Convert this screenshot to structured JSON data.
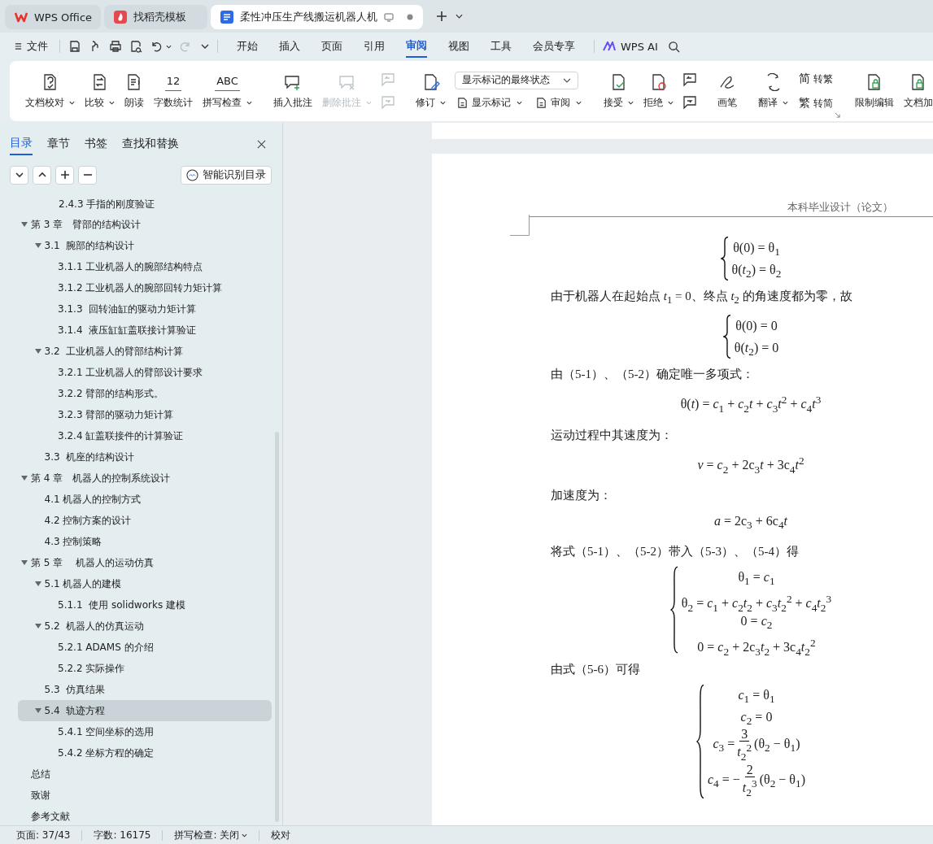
{
  "browser_tabs": [
    {
      "kind": "home",
      "label": "WPS Office",
      "selected": false
    },
    {
      "kind": "template",
      "label": "找稻壳模板",
      "selected": false
    },
    {
      "kind": "document",
      "label": "柔性冲压生产线搬运机器人机",
      "selected": true
    }
  ],
  "menu": {
    "file": "文件",
    "quick_access": [
      {
        "disabled": false,
        "dropdown": false
      },
      {
        "disabled": false,
        "dropdown": false
      },
      {
        "disabled": false,
        "dropdown": false
      },
      {
        "disabled": false,
        "dropdown": false
      },
      {
        "disabled": false,
        "dropdown": true
      },
      {
        "disabled": true,
        "dropdown": false
      }
    ],
    "tabs": [
      {
        "label": "开始",
        "selected": false
      },
      {
        "label": "插入",
        "selected": false
      },
      {
        "label": "页面",
        "selected": false
      },
      {
        "label": "引用",
        "selected": false
      },
      {
        "label": "审阅",
        "selected": true
      },
      {
        "label": "视图",
        "selected": false
      },
      {
        "label": "工具",
        "selected": false
      },
      {
        "label": "会员专享",
        "selected": false
      }
    ],
    "ai": "WPS AI"
  },
  "ribbon": {
    "groups": [
      {
        "items": [
          {
            "kind": "large",
            "label": "文档校对",
            "dropdown": true,
            "disabled": false
          },
          {
            "kind": "large",
            "label": "比较",
            "dropdown": true,
            "disabled": false
          },
          {
            "kind": "large",
            "label": "朗读",
            "dropdown": false,
            "disabled": false
          },
          {
            "kind": "large",
            "label": "字数统计",
            "dropdown": false,
            "disabled": false,
            "icon_text": "12"
          },
          {
            "kind": "large",
            "label": "拼写检查",
            "dropdown": true,
            "disabled": false,
            "icon_text": "ABC"
          }
        ]
      },
      {
        "items": [
          {
            "kind": "large",
            "label": "插入批注",
            "dropdown": false,
            "disabled": false
          },
          {
            "kind": "large",
            "label": "删除批注",
            "dropdown": true,
            "disabled": true
          },
          {
            "kind": "icon_stack",
            "disabled": true
          }
        ]
      },
      {
        "items": [
          {
            "kind": "large",
            "label": "修订",
            "dropdown": true,
            "disabled": false
          },
          {
            "kind": "panel",
            "select": "显示标记的最终状态",
            "buttons": [
              {
                "label": "显示标记",
                "dropdown": true
              },
              {
                "label": "审阅",
                "dropdown": true
              }
            ]
          }
        ]
      },
      {
        "items": [
          {
            "kind": "large",
            "label": "接受",
            "dropdown": true,
            "disabled": false
          },
          {
            "kind": "large",
            "label": "拒绝",
            "dropdown": true,
            "disabled": false
          },
          {
            "kind": "icon_stack",
            "disabled": false
          }
        ]
      },
      {
        "items": [
          {
            "kind": "large",
            "label": "画笔",
            "dropdown": false,
            "disabled": false
          }
        ]
      },
      {
        "items": [
          {
            "kind": "large",
            "label": "翻译",
            "dropdown": true,
            "disabled": false
          },
          {
            "kind": "small_stack",
            "buttons": [
              {
                "label": "转繁",
                "icon_text": "简"
              },
              {
                "label": "转简",
                "icon_text": "繁"
              }
            ]
          }
        ]
      },
      {
        "items": [
          {
            "kind": "large",
            "label": "限制编辑",
            "dropdown": false,
            "disabled": false
          },
          {
            "kind": "large",
            "label": "文档加",
            "dropdown": false,
            "disabled": false
          }
        ]
      }
    ]
  },
  "sidebar": {
    "tabs": [
      {
        "label": "目录",
        "selected": true
      },
      {
        "label": "章节",
        "selected": false
      },
      {
        "label": "书签",
        "selected": false
      },
      {
        "label": "查找和替换",
        "selected": false
      }
    ],
    "smart_button": "智能识别目录",
    "partial_item": "2.4.3 手指的刚度验证",
    "toc": [
      {
        "label": "第 3 章　臂部的结构设计",
        "expanded": true,
        "selected": false,
        "children": [
          {
            "label": "3.1  腕部的结构设计",
            "expanded": true,
            "selected": false,
            "children": [
              {
                "label": "3.1.1 工业机器人的腕部结构特点",
                "selected": false
              },
              {
                "label": "3.1.2 工业机器人的腕部回转力矩计算",
                "selected": false
              },
              {
                "label": "3.1.3  回转油缸的驱动力矩计算",
                "selected": false
              },
              {
                "label": "3.1.4  液压缸缸盖联接计算验证",
                "selected": false
              }
            ]
          },
          {
            "label": "3.2  工业机器人的臂部结构计算",
            "expanded": true,
            "selected": false,
            "children": [
              {
                "label": "3.2.1 工业机器人的臂部设计要求",
                "selected": false
              },
              {
                "label": "3.2.2 臂部的结构形式。",
                "selected": false
              },
              {
                "label": "3.2.3 臂部的驱动力矩计算",
                "selected": false
              },
              {
                "label": "3.2.4 缸盖联接件的计算验证",
                "selected": false
              }
            ]
          },
          {
            "label": "3.3  机座的结构设计",
            "selected": false
          }
        ]
      },
      {
        "label": "第 4 章　机器人的控制系统设计",
        "expanded": true,
        "selected": false,
        "children": [
          {
            "label": "4.1 机器人的控制方式",
            "selected": false
          },
          {
            "label": "4.2 控制方案的设计",
            "selected": false
          },
          {
            "label": "4.3 控制策略",
            "selected": false
          }
        ]
      },
      {
        "label": "第 5 章　 机器人的运动仿真",
        "expanded": true,
        "selected": false,
        "children": [
          {
            "label": "5.1 机器人的建模",
            "expanded": true,
            "selected": false,
            "children": [
              {
                "label": "5.1.1  使用 solidworks 建模",
                "selected": false
              }
            ]
          },
          {
            "label": "5.2  机器人的仿真运动",
            "expanded": true,
            "selected": false,
            "children": [
              {
                "label": "5.2.1 ADAMS 的介绍",
                "selected": false
              },
              {
                "label": "5.2.2 实际操作",
                "selected": false
              }
            ]
          },
          {
            "label": "5.3  仿真结果",
            "selected": false
          },
          {
            "label": "5.4  轨迹方程",
            "expanded": true,
            "selected": true,
            "children": [
              {
                "label": "5.4.1 空间坐标的选用",
                "selected": false
              },
              {
                "label": "5.4.2 坐标方程的确定",
                "selected": false
              }
            ]
          }
        ]
      },
      {
        "label": "总结",
        "selected": false
      },
      {
        "label": "致谢",
        "selected": false
      },
      {
        "label": "参考文献",
        "selected": false
      }
    ]
  },
  "document": {
    "header": "本科毕业设计（论文）",
    "blocks": [
      {
        "kind": "system",
        "rows": [
          {
            "kind": "plain",
            "text": "θ(0) = θ$_{1}$"
          },
          {
            "kind": "plain",
            "text": "θ(*t*$_{2}$) = θ$_{2}$"
          }
        ]
      },
      {
        "kind": "paragraph",
        "text": "由于机器人在起始点 *t*$_{1}$ = 0、终点 *t*$_{2}$ 的角速度都为零，故"
      },
      {
        "kind": "system",
        "rows": [
          {
            "kind": "plain",
            "text": "θ(0) = 0"
          },
          {
            "kind": "plain",
            "text": "θ(*t*$_{2}$) = 0"
          }
        ]
      },
      {
        "kind": "paragraph",
        "text": "由（5-1）、（5-2）确定唯一多项式："
      },
      {
        "kind": "formula",
        "text": "θ(*t*) = *c*$_{1}$ + *c*$_{2}$*t* + *c*$_{3}$*t*$^{2}$ + *c*$_{4}$*t*$^{3}$"
      },
      {
        "kind": "paragraph",
        "text": "运动过程中其速度为："
      },
      {
        "kind": "formula",
        "text": "*v* = *c*$_{2}$ + 2c$_{3}$*t* + 3c$_{4}$*t*$^{2}$"
      },
      {
        "kind": "paragraph",
        "text": "加速度为："
      },
      {
        "kind": "formula",
        "text": "*a* = 2c$_{3}$ + 6c$_{4}$*t*"
      },
      {
        "kind": "paragraph",
        "text": "将式（5-1）、（5-2）带入（5-3）、（5-4）得"
      },
      {
        "kind": "system",
        "rows": [
          {
            "kind": "plain",
            "text": "θ$_{1}$ = *c*$_{1}$"
          },
          {
            "kind": "plain",
            "text": "θ$_{2}$ = *c*$_{1}$ + *c*$_{2}$*t*$_{2}$ + *c*$_{3}$*t*$_{2}$$^{2}$ + *c*$_{4}$*t*$_{2}$$^{3}$"
          },
          {
            "kind": "plain",
            "text": "0 = *c*$_{2}$"
          },
          {
            "kind": "plain",
            "text": "0 = *c*$_{2}$ + 2c$_{3}$*t*$_{2}$ + 3c$_{4}$*t*$_{2}$$^{2}$"
          }
        ]
      },
      {
        "kind": "paragraph",
        "text": "由式（5-6）可得"
      },
      {
        "kind": "system",
        "rows": [
          {
            "kind": "plain",
            "text": "*c*$_{1}$ = θ$_{1}$"
          },
          {
            "kind": "plain",
            "text": "*c*$_{2}$ = 0"
          },
          {
            "kind": "fraction",
            "lhs": "*c*$_{3}$ =",
            "num": "3",
            "den": "*t*$_{2}$$^{2}$",
            "rhs": "(θ$_{2}$ − θ$_{1}$)"
          },
          {
            "kind": "fraction",
            "lhs": "*c*$_{4}$ = −",
            "num": "2",
            "den": "*t*$_{2}$$^{3}$",
            "rhs": "(θ$_{2}$ − θ$_{1}$)"
          }
        ]
      }
    ]
  },
  "status_bar": {
    "page": "页面: 37/43",
    "words": "字数: 16175",
    "spell_check": "拼写检查: 关闭",
    "proofread": "校对"
  }
}
